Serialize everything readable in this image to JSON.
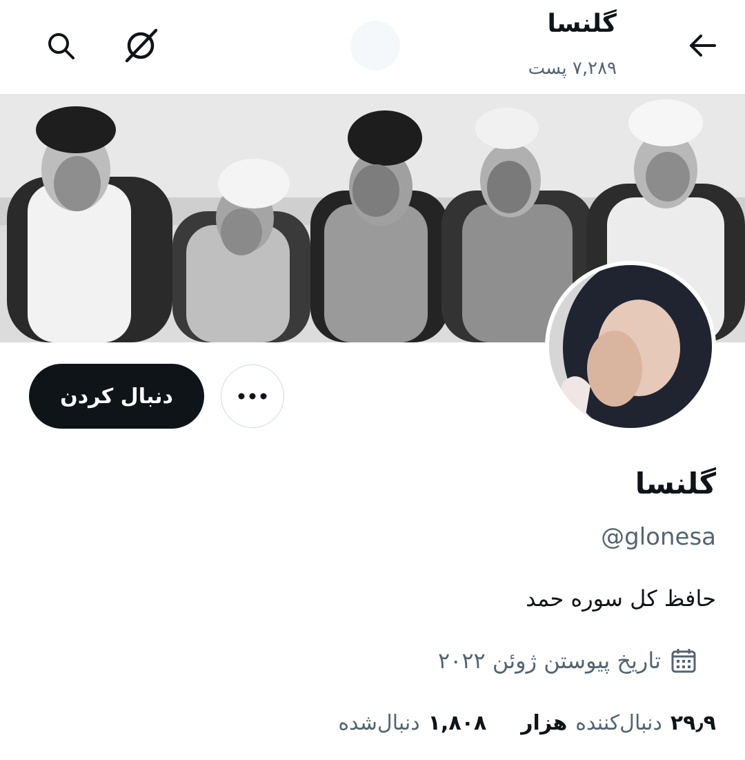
{
  "header": {
    "title": "گلنسا",
    "post_count": "۷,۲۸۹ پست"
  },
  "icons": {
    "back": "arrow-left-icon",
    "grok": "slashed-circle-icon",
    "search": "search-icon",
    "calendar": "calendar-icon"
  },
  "profile": {
    "display_name": "گلنسا",
    "handle": "@glonesa",
    "bio": "حافظ کل سوره حمد",
    "joined": "تاریخ پیوستن ژوئن ۲۰۲۲",
    "follow_label": "دنبال کردن"
  },
  "stats": {
    "following_value": "۱,۸۰۸",
    "following_label": "دنبال‌شده",
    "followers_value": "۲۹٫۹",
    "followers_unit": "هزار",
    "followers_label": "دنبال‌کننده"
  }
}
